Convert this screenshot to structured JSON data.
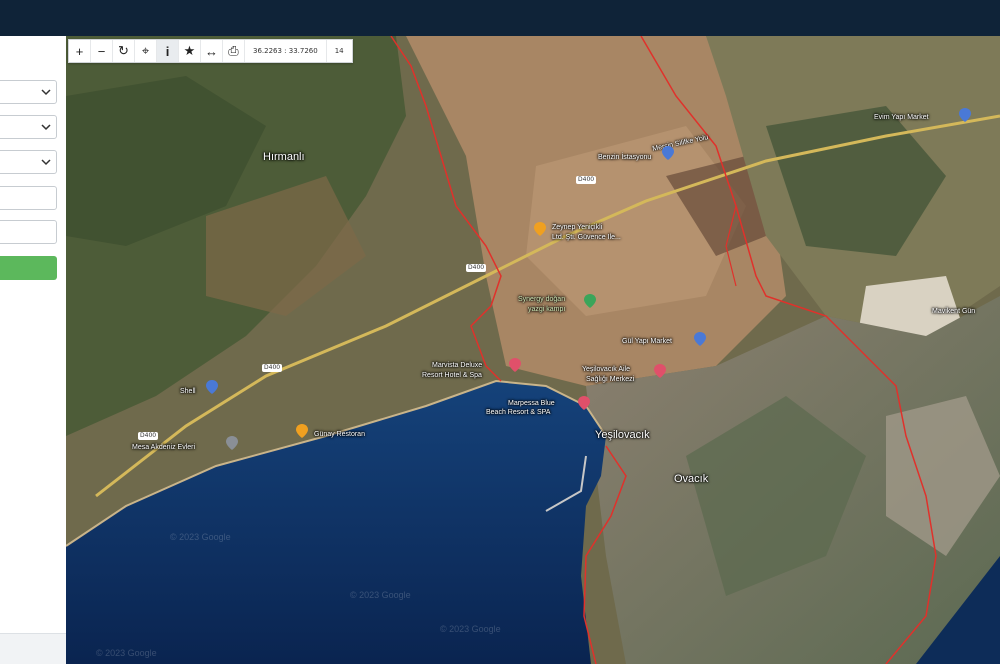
{
  "toolbar": {
    "buttons": [
      {
        "icon": "zoom-in-icon",
        "glyph": "+"
      },
      {
        "icon": "zoom-out-icon",
        "glyph": "−"
      },
      {
        "icon": "refresh-icon",
        "glyph": "↻"
      },
      {
        "icon": "locate-icon",
        "glyph": "⌖"
      },
      {
        "icon": "info-icon",
        "glyph": "i"
      },
      {
        "icon": "star-icon",
        "glyph": "★"
      },
      {
        "icon": "measure-icon",
        "glyph": "↔"
      },
      {
        "icon": "print-icon",
        "glyph": "⎙"
      }
    ],
    "coordinates": "36.2263 : 33.7260",
    "zoom_level": "14"
  },
  "map": {
    "places": {
      "hirmanli": "Hırmanlı",
      "yesilovacik": "Yeşilovacık",
      "ovacik": "Ovacık"
    },
    "pois": {
      "evim_yapi_market": "Evim Yapı Market",
      "benzin_istasyonu": "Benzin İstasyonu",
      "zeynep_yenicikli": "Zeynep Yeniçikli",
      "zeynep_yenicikli_2": "Ltd. Şti. Güvence Ile...",
      "synergy_doga_1": "Synergy doğan",
      "synergy_doga_2": "yazgi kampı",
      "gul_yapi_market": "Gül Yapı Market",
      "yesilovacik_aile_1": "Yeşilovacık Aile",
      "yesilovacik_aile_2": "Sağlığı Merkezi",
      "marvista_1": "Marvista Deluxe",
      "marvista_2": "Resort Hotel & Spa",
      "marpessa_1": "Marpessa Blue",
      "marpessa_2": "Beach Resort & SPA",
      "shell": "Shell",
      "mesa_evleri": "Mesa Akdeniz Evleri",
      "gunay_restoran": "Günay Restoran",
      "mavikent": "Mavikent Gün"
    },
    "roads": {
      "d400_a": "D400",
      "d400_b": "D400",
      "d400_c": "D400",
      "d400_d": "D400",
      "ekinci_cad": "Mersin Silifke Yolu"
    },
    "watermark": "© 2023 Google"
  },
  "colors": {
    "topbar": "#0f2338",
    "sea": "#0e2f5c",
    "boundary": "#e0312b",
    "go_button": "#5cb85c"
  }
}
